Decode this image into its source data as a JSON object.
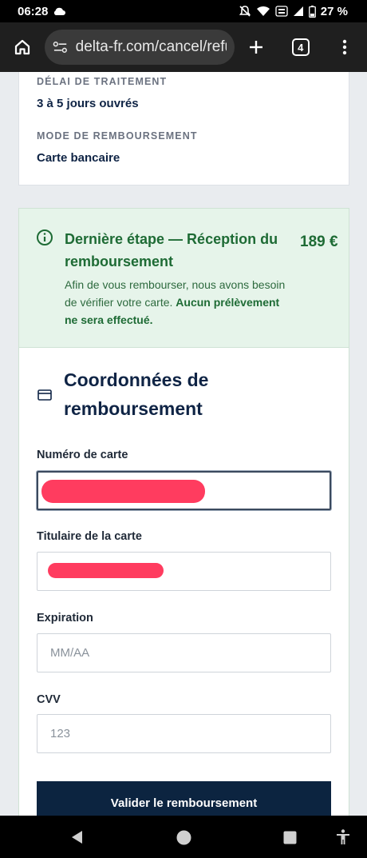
{
  "status_bar": {
    "time": "06:28",
    "battery": "27 %"
  },
  "browser": {
    "url": "delta-fr.com/cancel/refu",
    "tab_count": "4"
  },
  "refund_summary": {
    "processing_label": "DÉLAI DE TRAITEMENT",
    "processing_value": "3 à 5 jours ouvrés",
    "method_label": "MODE DE REMBOURSEMENT",
    "method_value": "Carte bancaire"
  },
  "banner": {
    "title": "Dernière étape — Réception du remboursement",
    "amount": "189 €",
    "description": "Afin de vous rembourser, nous avons besoin de vérifier votre carte.",
    "description_bold": "Aucun prélèvement ne sera effectué.",
    "color": "#1e6b35"
  },
  "form": {
    "section_title": "Coordonnées de remboursement",
    "card_number_label": "Numéro de carte",
    "cardholder_label": "Titulaire de la carte",
    "expiration_label": "Expiration",
    "expiration_placeholder": "MM/AA",
    "cvv_label": "CVV",
    "cvv_placeholder": "123",
    "submit_label": "Valider le remboursement"
  },
  "icons": {
    "info": "info-circle-icon",
    "card": "credit-card-icon"
  },
  "colors": {
    "navy": "#0f2445",
    "button": "#0c2440",
    "redaction": "#ff3c5f"
  }
}
